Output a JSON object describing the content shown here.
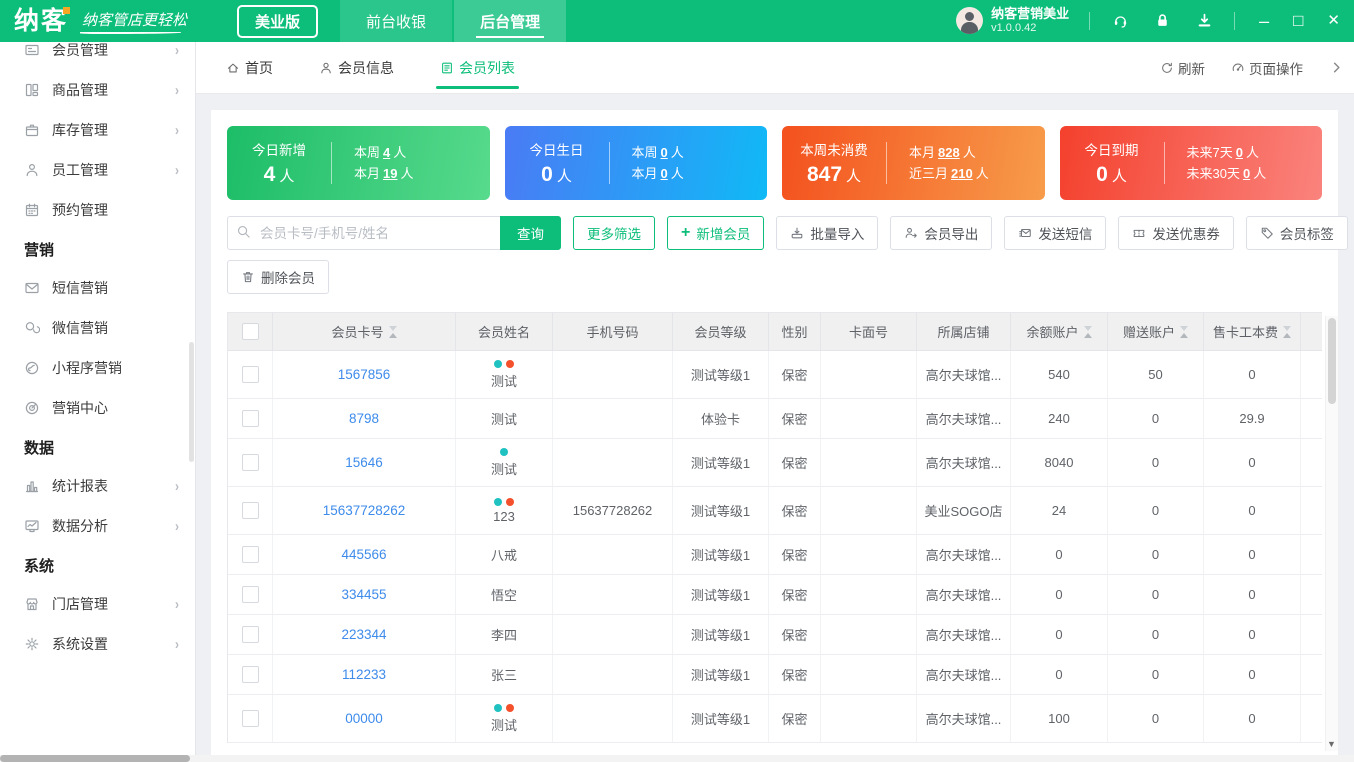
{
  "window": {
    "logo_text": "纳客",
    "tagline": "纳客管店更轻松",
    "edition_badge": "美业版",
    "nav_tabs": [
      {
        "key": "front-cashier",
        "label": "前台收银",
        "active": false
      },
      {
        "key": "backend-manage",
        "label": "后台管理",
        "active": true
      }
    ],
    "user": {
      "name": "纳客营销美业",
      "version": "v1.0.0.42"
    },
    "header_icons": [
      {
        "key": "customer-service",
        "icon": "headset-icon"
      },
      {
        "key": "lock",
        "icon": "lock-icon"
      },
      {
        "key": "download",
        "icon": "download-icon"
      }
    ],
    "controls": {
      "minimize": "–",
      "maximize": "□",
      "close": "✕"
    }
  },
  "colors": {
    "accent_green": "#0cbe7a",
    "link_blue": "#3d8bea",
    "dot_teal": "#1fc1c1",
    "dot_red": "#f4502c"
  },
  "sidebar": {
    "items": [
      {
        "type": "item",
        "key": "member-management",
        "label": "会员管理",
        "icon": "member-card-icon",
        "arrow": true
      },
      {
        "type": "item",
        "key": "goods-management",
        "label": "商品管理",
        "icon": "goods-icon",
        "arrow": true
      },
      {
        "type": "item",
        "key": "inventory-management",
        "label": "库存管理",
        "icon": "inventory-icon",
        "arrow": true
      },
      {
        "type": "item",
        "key": "staff-management",
        "label": "员工管理",
        "icon": "staff-icon",
        "arrow": true
      },
      {
        "type": "item",
        "key": "booking-management",
        "label": "预约管理",
        "icon": "calendar-icon",
        "arrow": false
      },
      {
        "type": "section",
        "key": "marketing",
        "label": "营销"
      },
      {
        "type": "item",
        "key": "sms-marketing",
        "label": "短信营销",
        "icon": "sms-icon",
        "arrow": false
      },
      {
        "type": "item",
        "key": "wechat-marketing",
        "label": "微信营销",
        "icon": "wechat-icon",
        "arrow": false
      },
      {
        "type": "item",
        "key": "miniprogram-marketing",
        "label": "小程序营销",
        "icon": "miniprogram-icon",
        "arrow": false
      },
      {
        "type": "item",
        "key": "marketing-center",
        "label": "营销中心",
        "icon": "target-icon",
        "arrow": false
      },
      {
        "type": "section",
        "key": "data",
        "label": "数据"
      },
      {
        "type": "item",
        "key": "statistic-report",
        "label": "统计报表",
        "icon": "report-icon",
        "arrow": true
      },
      {
        "type": "item",
        "key": "data-analysis",
        "label": "数据分析",
        "icon": "analysis-icon",
        "arrow": true
      },
      {
        "type": "section",
        "key": "system",
        "label": "系统"
      },
      {
        "type": "item",
        "key": "store-management",
        "label": "门店管理",
        "icon": "store-icon",
        "arrow": true
      },
      {
        "type": "item",
        "key": "system-settings",
        "label": "系统设置",
        "icon": "settings-icon",
        "arrow": true
      }
    ]
  },
  "tabbar": {
    "tabs": [
      {
        "key": "home",
        "label": "首页",
        "icon": "home-icon",
        "active": false
      },
      {
        "key": "member-info",
        "label": "会员信息",
        "icon": "user-icon",
        "active": false
      },
      {
        "key": "member-list",
        "label": "会员列表",
        "icon": "list-icon",
        "active": true
      }
    ],
    "refresh_label": "刷新",
    "page_ops_label": "页面操作"
  },
  "stat_cards": [
    {
      "key": "today-new",
      "title": "今日新增",
      "value": "4",
      "unit": "人",
      "rows": [
        {
          "label": "本周",
          "value": "4",
          "unit": "人"
        },
        {
          "label": "本月",
          "value": "19",
          "unit": "人"
        }
      ],
      "gradient": [
        "#1dbd68",
        "#57da8c"
      ]
    },
    {
      "key": "today-birthday",
      "title": "今日生日",
      "value": "0",
      "unit": "人",
      "rows": [
        {
          "label": "本周",
          "value": "0",
          "unit": "人"
        },
        {
          "label": "本月",
          "value": "0",
          "unit": "人"
        }
      ],
      "gradient": [
        "#4a7bf5",
        "#10b9f6"
      ]
    },
    {
      "key": "week-no-consume",
      "title": "本周未消费",
      "value": "847",
      "unit": "人",
      "rows": [
        {
          "label": "本月",
          "value": "828",
          "unit": "人"
        },
        {
          "label": "近三月",
          "value": "210",
          "unit": "人"
        }
      ],
      "gradient": [
        "#f4511e",
        "#f79c4a"
      ]
    },
    {
      "key": "today-expire",
      "title": "今日到期",
      "value": "0",
      "unit": "人",
      "rows": [
        {
          "label": "未来7天",
          "value": "0",
          "unit": "人"
        },
        {
          "label": "未来30天",
          "value": "0",
          "unit": "人"
        }
      ],
      "gradient": [
        "#f4412d",
        "#fa837d"
      ]
    }
  ],
  "toolbar": {
    "search_placeholder": "会员卡号/手机号/姓名",
    "search_button": "查询",
    "buttons": [
      {
        "key": "more-filter",
        "label": "更多筛选",
        "style": "outline",
        "icon": null
      },
      {
        "key": "add-member",
        "label": "新增会员",
        "style": "outline",
        "icon": "plus-icon"
      },
      {
        "key": "batch-import",
        "label": "批量导入",
        "style": "plain",
        "icon": "import-icon"
      },
      {
        "key": "member-export",
        "label": "会员导出",
        "style": "plain",
        "icon": "export-icon"
      },
      {
        "key": "send-sms",
        "label": "发送短信",
        "style": "plain",
        "icon": "send-sms-icon"
      },
      {
        "key": "send-coupon",
        "label": "发送优惠券",
        "style": "plain",
        "icon": "coupon-icon"
      },
      {
        "key": "member-tag",
        "label": "会员标签",
        "style": "plain",
        "icon": "tag-icon"
      }
    ],
    "delete_button": {
      "key": "delete-member",
      "label": "删除会员",
      "icon": "trash-icon"
    }
  },
  "table": {
    "columns": [
      {
        "key": "card_no",
        "label": "会员卡号",
        "sortable": true
      },
      {
        "key": "name",
        "label": "会员姓名",
        "sortable": false
      },
      {
        "key": "phone",
        "label": "手机号码",
        "sortable": false
      },
      {
        "key": "level",
        "label": "会员等级",
        "sortable": false
      },
      {
        "key": "gender",
        "label": "性别",
        "sortable": false
      },
      {
        "key": "card_face",
        "label": "卡面号",
        "sortable": false
      },
      {
        "key": "store",
        "label": "所属店铺",
        "sortable": false
      },
      {
        "key": "balance",
        "label": "余额账户",
        "sortable": true
      },
      {
        "key": "gift",
        "label": "赠送账户",
        "sortable": true
      },
      {
        "key": "fee",
        "label": "售卡工本费",
        "sortable": true
      }
    ],
    "rows": [
      {
        "card_no": "1567856",
        "name": "测试",
        "dots": [
          "teal",
          "red"
        ],
        "phone": "",
        "level": "测试等级1",
        "gender": "保密",
        "card_face": "",
        "store": "高尔夫球馆...",
        "balance": "540",
        "gift": "50",
        "fee": "0"
      },
      {
        "card_no": "8798",
        "name": "测试",
        "dots": [],
        "phone": "",
        "level": "体验卡",
        "gender": "保密",
        "card_face": "",
        "store": "高尔夫球馆...",
        "balance": "240",
        "gift": "0",
        "fee": "29.9"
      },
      {
        "card_no": "15646",
        "name": "测试",
        "dots": [
          "teal"
        ],
        "phone": "",
        "level": "测试等级1",
        "gender": "保密",
        "card_face": "",
        "store": "高尔夫球馆...",
        "balance": "8040",
        "gift": "0",
        "fee": "0"
      },
      {
        "card_no": "15637728262",
        "name": "123",
        "dots": [
          "teal",
          "red"
        ],
        "phone": "15637728262",
        "level": "测试等级1",
        "gender": "保密",
        "card_face": "",
        "store": "美业SOGO店",
        "balance": "24",
        "gift": "0",
        "fee": "0"
      },
      {
        "card_no": "445566",
        "name": "八戒",
        "dots": [],
        "phone": "",
        "level": "测试等级1",
        "gender": "保密",
        "card_face": "",
        "store": "高尔夫球馆...",
        "balance": "0",
        "gift": "0",
        "fee": "0"
      },
      {
        "card_no": "334455",
        "name": "悟空",
        "dots": [],
        "phone": "",
        "level": "测试等级1",
        "gender": "保密",
        "card_face": "",
        "store": "高尔夫球馆...",
        "balance": "0",
        "gift": "0",
        "fee": "0"
      },
      {
        "card_no": "223344",
        "name": "李四",
        "dots": [],
        "phone": "",
        "level": "测试等级1",
        "gender": "保密",
        "card_face": "",
        "store": "高尔夫球馆...",
        "balance": "0",
        "gift": "0",
        "fee": "0"
      },
      {
        "card_no": "112233",
        "name": "张三",
        "dots": [],
        "phone": "",
        "level": "测试等级1",
        "gender": "保密",
        "card_face": "",
        "store": "高尔夫球馆...",
        "balance": "0",
        "gift": "0",
        "fee": "0"
      },
      {
        "card_no": "00000",
        "name": "测试",
        "dots": [
          "teal",
          "red"
        ],
        "phone": "",
        "level": "测试等级1",
        "gender": "保密",
        "card_face": "",
        "store": "高尔夫球馆...",
        "balance": "100",
        "gift": "0",
        "fee": "0"
      }
    ]
  }
}
